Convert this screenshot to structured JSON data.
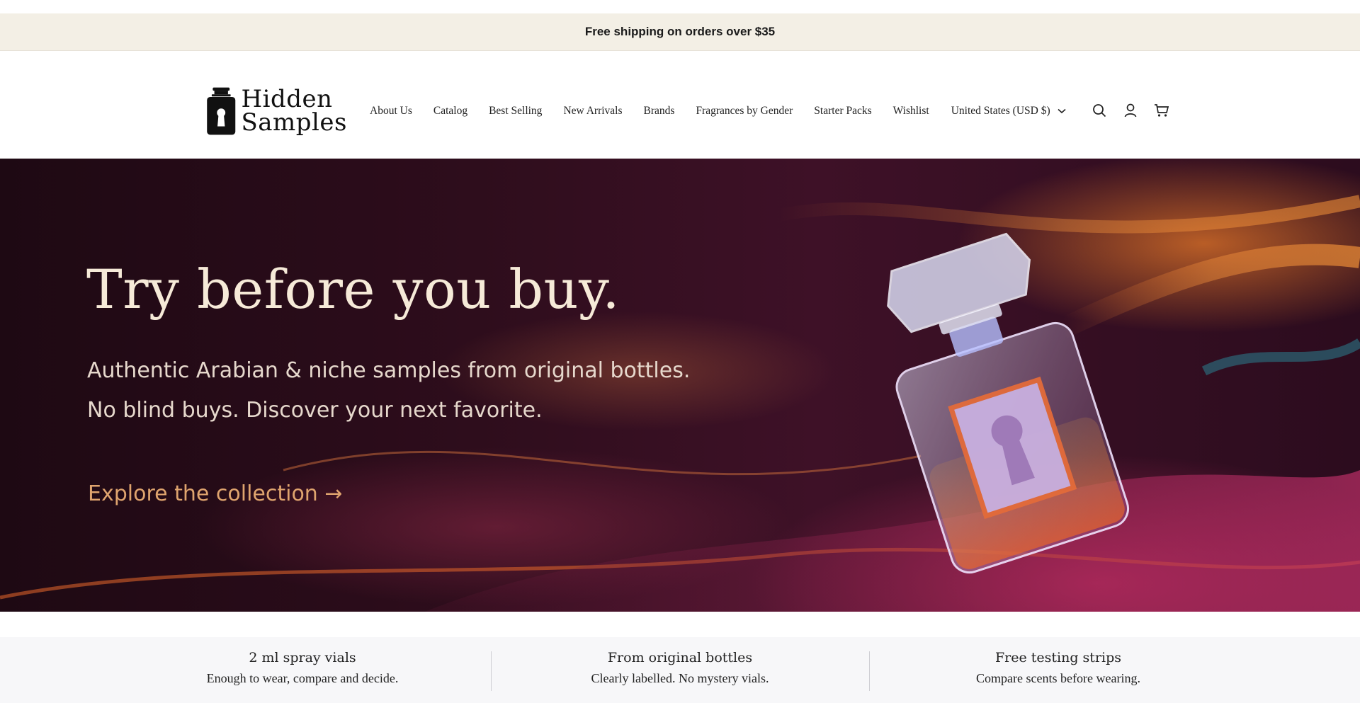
{
  "announcement": {
    "text": "Free shipping on orders over $35"
  },
  "brand": {
    "line1": "Hidden",
    "line2": "Samples"
  },
  "nav": {
    "items": [
      "About Us",
      "Catalog",
      "Best Selling",
      "New Arrivals",
      "Brands",
      "Fragrances by Gender",
      "Starter Packs",
      "Wishlist"
    ],
    "country_selector": "United States (USD $)"
  },
  "header_icons": [
    "search-icon",
    "account-icon",
    "cart-icon"
  ],
  "hero": {
    "title": "Try before you buy.",
    "subtitle_line1": "Authentic Arabian & niche samples from original bottles.",
    "subtitle_line2": "No blind buys. Discover your next favorite.",
    "cta": "Explore the collection →"
  },
  "features": [
    {
      "title": "2 ml spray vials",
      "desc": "Enough to wear, compare and decide."
    },
    {
      "title": "From original bottles",
      "desc": "Clearly labelled. No mystery vials."
    },
    {
      "title": "Free testing strips",
      "desc": "Compare scents before wearing."
    }
  ],
  "colors": {
    "announcement_bg": "#f3efe5",
    "hero_title": "#f6ead8",
    "cta": "#dfa46e",
    "features_bg": "#f7f7f9"
  }
}
